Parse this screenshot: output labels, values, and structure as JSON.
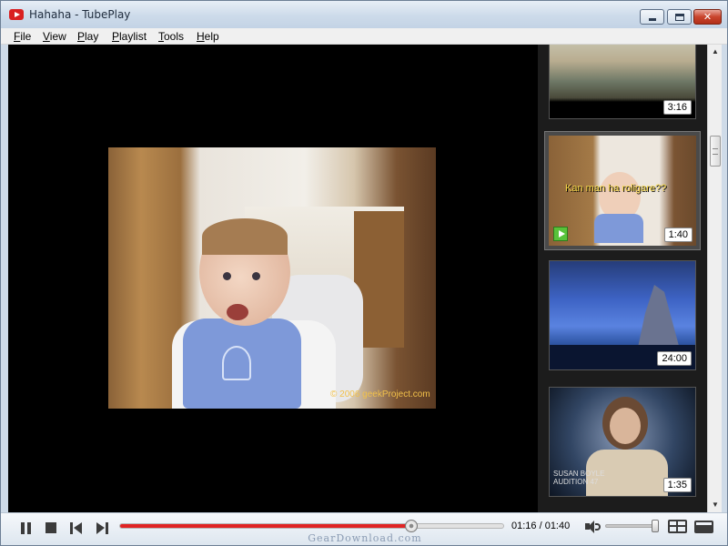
{
  "window": {
    "title": "Hahaha - TubePlay",
    "controls": {
      "minimize": "minimize",
      "maximize": "maximize",
      "close": "✕"
    }
  },
  "menu": [
    {
      "key": "F",
      "rest": "ile"
    },
    {
      "key": "V",
      "rest": "iew"
    },
    {
      "key": "P",
      "rest": "lay"
    },
    {
      "key": "P",
      "rest": "laylist"
    },
    {
      "key": "T",
      "rest": "ools"
    },
    {
      "key": "H",
      "rest": "elp"
    }
  ],
  "video": {
    "watermark": "© 2006 geekProject.com"
  },
  "playlist": {
    "items": [
      {
        "duration": "3:16",
        "selected": false
      },
      {
        "duration": "1:40",
        "selected": true,
        "overlay": "Kan man ha roligare??"
      },
      {
        "duration": "24:00",
        "selected": false
      },
      {
        "duration": "1:35",
        "selected": false,
        "overlay_lines": [
          "SUSAN BOYLE",
          "AUDITION 47"
        ]
      }
    ]
  },
  "player": {
    "current_time": "01:16",
    "total_time": "01:40",
    "time_display": "01:16 / 01:40",
    "progress": 0.76,
    "volume": 1.0,
    "accent_color": "#e02424"
  },
  "footer": {
    "site": "GearDownload.com"
  },
  "icons": {
    "app": "tubeplay-logo-icon",
    "pause": "pause-icon",
    "stop": "stop-icon",
    "previous": "previous-track-icon",
    "next": "next-track-icon",
    "volume": "speaker-icon",
    "layout_grid": "grid-view-icon",
    "layout_compact": "compact-view-icon"
  }
}
